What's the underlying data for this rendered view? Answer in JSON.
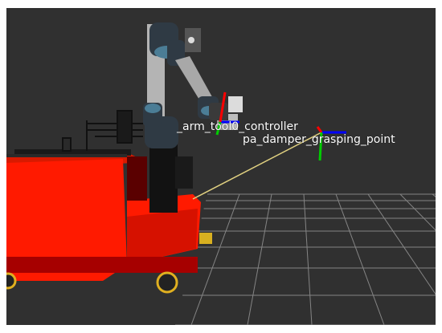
{
  "viewport": {
    "background": "#303030",
    "grid_color": "#a0a0a0"
  },
  "labels": {
    "controller_frame": "_arm_tool0_controller",
    "target_frame": "pa_damper_grasping_point"
  },
  "colors": {
    "robot_base": "#ff1a00",
    "robot_shadow": "#b00000",
    "arm_link": "#a8a8a8",
    "arm_joint": "#2f3a44",
    "joint_cap": "#4b7d96",
    "axis_x": "#ff0000",
    "axis_y": "#00cc00",
    "axis_z": "#0000ff",
    "connector_line": "#e0d080",
    "wheel": "#e0b020"
  }
}
